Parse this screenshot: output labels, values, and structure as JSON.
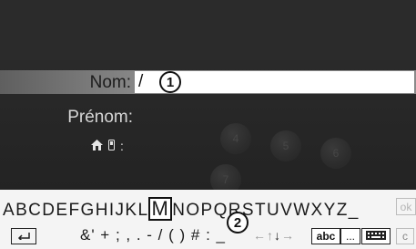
{
  "form": {
    "name_label": "Nom:",
    "name_value": "/",
    "firstname_label": "Prénom:",
    "phone_separator": ":"
  },
  "callouts": {
    "one": "1",
    "two": "2"
  },
  "keypad": {
    "k4": "4",
    "k5": "5",
    "k6": "6",
    "k7": "7"
  },
  "keyboard": {
    "letters": [
      "A",
      "B",
      "C",
      "D",
      "E",
      "F",
      "G",
      "H",
      "I",
      "J",
      "K",
      "L",
      "M",
      "N",
      "O",
      "P",
      "Q",
      "R",
      "S",
      "T",
      "U",
      "V",
      "W",
      "X",
      "Y",
      "Z",
      "_"
    ],
    "selected_index": 12,
    "ok_label": "ok",
    "symbols": "&' + ; , . - / ( ) # : ",
    "space_label": "_",
    "arrow_left": "←",
    "arrow_up": "↑",
    "arrow_down": "↓",
    "arrow_right": "→",
    "abc_label": "abc",
    "dots_label": "...",
    "c_label": "c",
    "back_icon": "back-arrow-icon"
  },
  "colors": {
    "highlight_row": "#8a8a8a",
    "keyboard_bg": "#f4f4f4",
    "screen_bg": "#2b2b2b"
  }
}
